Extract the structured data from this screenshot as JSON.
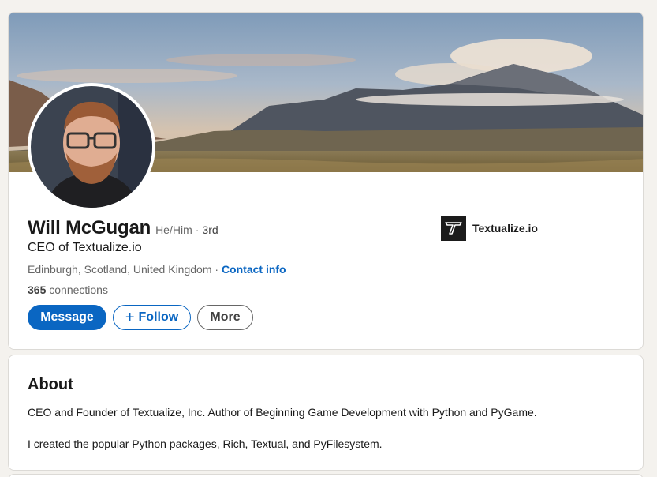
{
  "profile": {
    "name": "Will McGugan",
    "pronouns": "He/Him",
    "separator": "·",
    "degree": "3rd",
    "headline": "CEO of Textualize.io",
    "location": "Edinburgh, Scotland, United Kingdom",
    "location_separator": " · ",
    "contact_info": "Contact info",
    "connections_count": "365",
    "connections_label": "connections"
  },
  "actions": {
    "message": "Message",
    "follow": "Follow",
    "more": "More"
  },
  "company": {
    "name": "Textualize.io",
    "logo_icon": "textualize-t-logo"
  },
  "about": {
    "title": "About",
    "paragraph1": "CEO and Founder of Textualize, Inc. Author of Beginning Game Development with Python and PyGame.",
    "paragraph2": "I created the popular Python packages, Rich, Textual, and PyFilesystem."
  },
  "colors": {
    "accent": "#0a66c2",
    "background": "#f4f2ee"
  }
}
